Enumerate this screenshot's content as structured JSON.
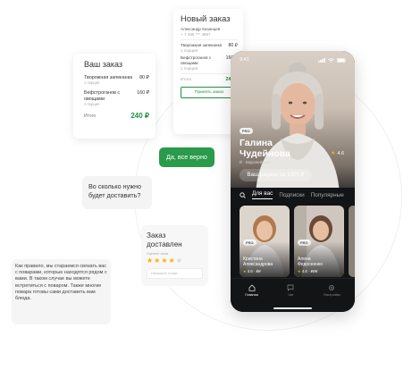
{
  "new_order": {
    "title": "Новый заказ",
    "customer": "Александр Казанцев",
    "phone": "+ 7 495 *** 4897",
    "items": [
      {
        "name": "Творожная запеканка",
        "qty": "1 порция",
        "price": "80 ₽"
      },
      {
        "name": "Бефстроганов с овощами",
        "qty": "1 порция",
        "price": "160 ₽"
      }
    ],
    "total_label": "Итого",
    "total_value": "240 ₽",
    "accept_label": "Принять заказ"
  },
  "your_order": {
    "title": "Ваш заказ",
    "items": [
      {
        "name": "Творожная запеканка",
        "qty": "1 порция",
        "price": "80 ₽"
      },
      {
        "name": "Бефстроганов с овощами",
        "qty": "1 порция",
        "price": "160 ₽"
      }
    ],
    "total_label": "Итого",
    "total_value": "240 ₽"
  },
  "chat": {
    "reply": "Да, все верно",
    "question": "Во сколько нужно будет доставить?",
    "info": "Как правило, мы стараемся связать вас с поварами, которые находятся рядом с вами. В таком случае вы можете встретиться с поваром. Также многие повара готовы сами доставить вам блюда."
  },
  "delivered": {
    "title": "Заказ доставлен",
    "rate_label": "Оцените заказ",
    "rating": 4,
    "max_rating": 5,
    "comment_placeholder": "Напишите отзыв"
  },
  "phone": {
    "time": "9:41",
    "badge": "PRO",
    "chef_name_line1": "Галина",
    "chef_name_line2": "Чудейнова",
    "rating": "4.6",
    "cuisine": "₽ · Европейская",
    "ration_button": "Ваш рацион за 1000 ₽",
    "tabs": [
      "Для вас",
      "Подписки",
      "Популярные"
    ],
    "cards": [
      {
        "badge": "PRO",
        "name_line1": "Кристина",
        "name_line2": "Александрова",
        "meta": "4.6 · ₽₽"
      },
      {
        "badge": "PRO",
        "name_line1": "Алена",
        "name_line2": "Федосеенко",
        "meta": "4.8 · ₽₽₽"
      }
    ],
    "nav": [
      "Главная",
      "Чат",
      "Настройки"
    ]
  },
  "colors": {
    "accent_green": "#2a9a4b",
    "star": "#f5b400"
  }
}
